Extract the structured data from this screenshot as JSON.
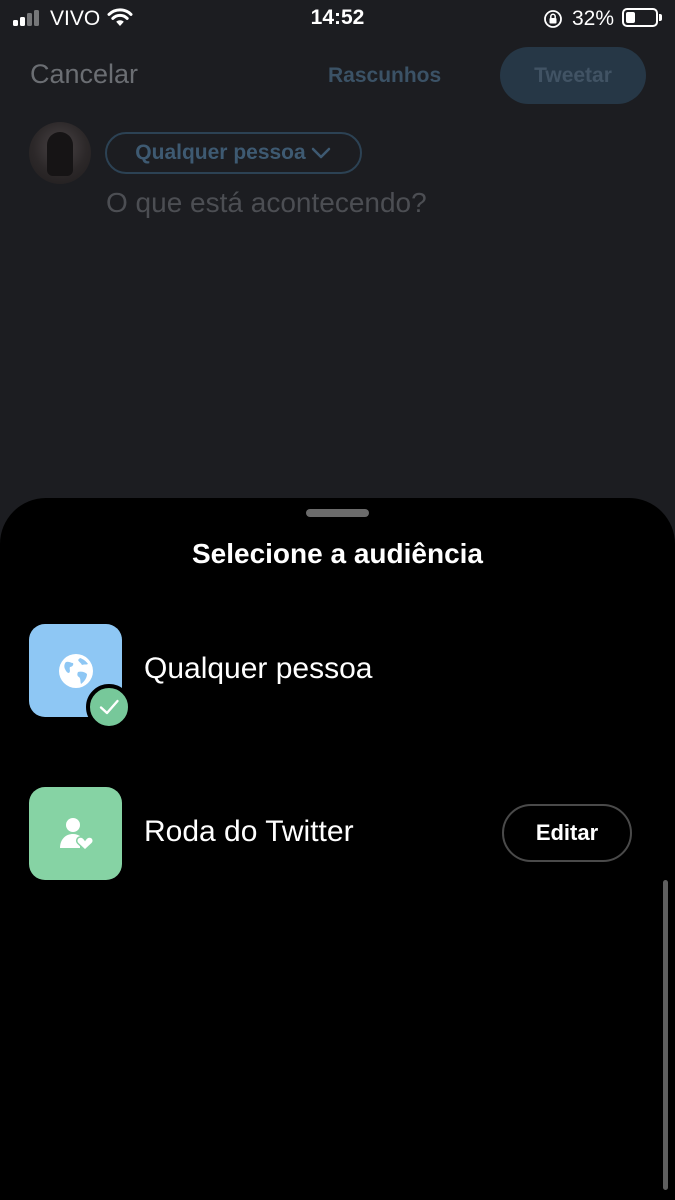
{
  "status_bar": {
    "carrier": "VIVO",
    "time": "14:52",
    "battery_percent": "32%",
    "battery_level": 0.32
  },
  "composer": {
    "cancel_label": "Cancelar",
    "drafts_label": "Rascunhos",
    "tweet_label": "Tweetar",
    "audience_chip_label": "Qualquer pessoa",
    "placeholder": "O que está acontecendo?"
  },
  "sheet": {
    "title": "Selecione a audiência",
    "options": [
      {
        "label": "Qualquer pessoa",
        "icon": "globe-icon",
        "icon_bg": "#8ec7f4",
        "selected": true
      },
      {
        "label": "Roda do Twitter",
        "icon": "person-heart-icon",
        "icon_bg": "#86d3a4",
        "selected": false,
        "action_label": "Editar"
      }
    ]
  },
  "colors": {
    "background": "#1c1d21",
    "sheet_background": "#000000",
    "check_green": "#77c89a",
    "tweet_button_disabled": "#263746"
  }
}
